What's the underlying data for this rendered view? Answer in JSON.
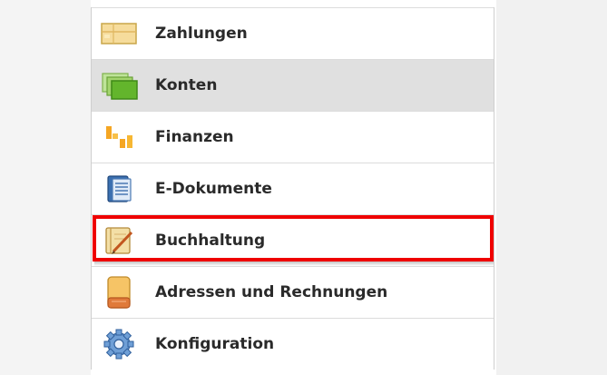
{
  "nav": {
    "items": [
      {
        "label": "Zahlungen",
        "icon": "payments-icon"
      },
      {
        "label": "Konten",
        "icon": "accounts-icon",
        "active": true
      },
      {
        "label": "Finanzen",
        "icon": "finance-chart-icon"
      },
      {
        "label": "E-Dokumente",
        "icon": "e-documents-icon"
      },
      {
        "label": "Buchhaltung",
        "icon": "accounting-book-icon",
        "highlighted": true
      },
      {
        "label": "Adressen und Rechnungen",
        "icon": "address-book-icon"
      },
      {
        "label": "Konfiguration",
        "icon": "gear-icon"
      }
    ]
  },
  "colors": {
    "active_row": "#e0e0e0",
    "highlight_border": "#ef0000",
    "label_text": "#2a2a2a"
  }
}
